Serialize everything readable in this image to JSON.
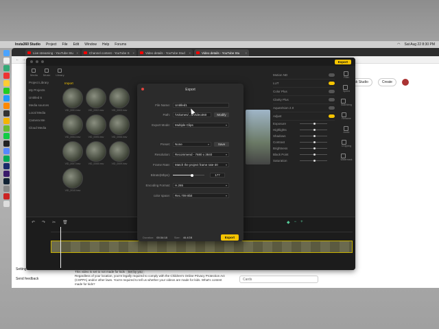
{
  "menubar": {
    "app_name": "Insta360 Studio",
    "items": [
      "Project",
      "File",
      "Edit",
      "Window",
      "Help",
      "Forums"
    ],
    "clock": "Sat Aug 22  8:30 PM",
    "status_pill": "New Chrome available"
  },
  "chrome": {
    "tabs": [
      {
        "label": "Live streaming - YouTube Stu",
        "active": false
      },
      {
        "label": "Channel content - YouTube S",
        "active": false
      },
      {
        "label": "Video details - YouTube Stud",
        "active": false
      },
      {
        "label": "Video details - YouTube Stu",
        "active": true
      }
    ],
    "ask_studio": "Ask Studio",
    "create": "Create",
    "settings": "Settings",
    "send_feedback": "Send feedback",
    "notice_title": "This video is set to not made for kids",
    "notice_tag": "Set by you",
    "notice_body": "Regardless of your location, you're legally required to comply with the Children's Online Privacy Protection Act (COPPA) and/or other laws. You're required to tell us whether your videos are made for kids. What's content made for kids?",
    "cards": "Cards"
  },
  "insta": {
    "top_label": "Export",
    "tools": [
      "Media",
      "Music",
      "Library"
    ],
    "library_left": [
      "Project Library",
      "My Projects",
      "Untitled 6",
      "Media sources",
      "Local Media",
      "Camera Me",
      "Cloud Media"
    ],
    "import_btn": "Import",
    "thumbs": [
      "VID_0001.insv",
      "VID_0002.insv",
      "VID_0003.insv",
      "VID_0004.insv",
      "VID_0005.insv",
      "VID_0006.insv",
      "VID_0007.insv",
      "VID_0008.insv",
      "VID_0009.insv",
      "VID_0010.insv"
    ],
    "right_panel": {
      "toggles": [
        {
          "label": "Motion ND",
          "on": false
        },
        {
          "label": "LUT",
          "on": true
        },
        {
          "label": "Color Plus",
          "on": false
        },
        {
          "label": "Clarity Plus",
          "on": false
        },
        {
          "label": "AquaVision 2.0",
          "on": false
        },
        {
          "label": "Adjust",
          "on": true
        }
      ],
      "sliders": [
        "Exposure",
        "Highlights",
        "Shadows",
        "Contrast",
        "Brightness",
        "Black Point",
        "Saturation"
      ]
    },
    "far_right": [
      "Filter",
      "Speed",
      "Stabilizing",
      "Reframe",
      "Audio",
      "Cropping",
      "Watermark"
    ]
  },
  "dialog": {
    "title": "Export",
    "file_name_label": "File Name:",
    "file_name": "Untitled1",
    "path_label": "Path:",
    "path": "/Volumes/...d/Video360",
    "modify": "Modify",
    "export_mode_label": "Export Mode:",
    "export_mode": "Multiple Clips",
    "preset_label": "Preset:",
    "preset": "None",
    "save": "Save",
    "resolution_label": "Resolution:",
    "resolution": "Recommend - 7680 x 3840",
    "frame_rate_label": "Frame Rate:",
    "frame_rate": "Match the project frame rate-30",
    "bitrate_label": "Bitrate(Mbps):",
    "bitrate": "177",
    "bitrate_fraction": 0.6,
    "encoding_label": "Encoding Format:",
    "encoding": "H.265",
    "color_space_label": "color space:",
    "color_space": "Rec.709 8bit",
    "duration_label": "Duration:",
    "duration": "00:34:18",
    "size_label": "Size:",
    "size": "46.4GB",
    "export_button": "Export"
  }
}
